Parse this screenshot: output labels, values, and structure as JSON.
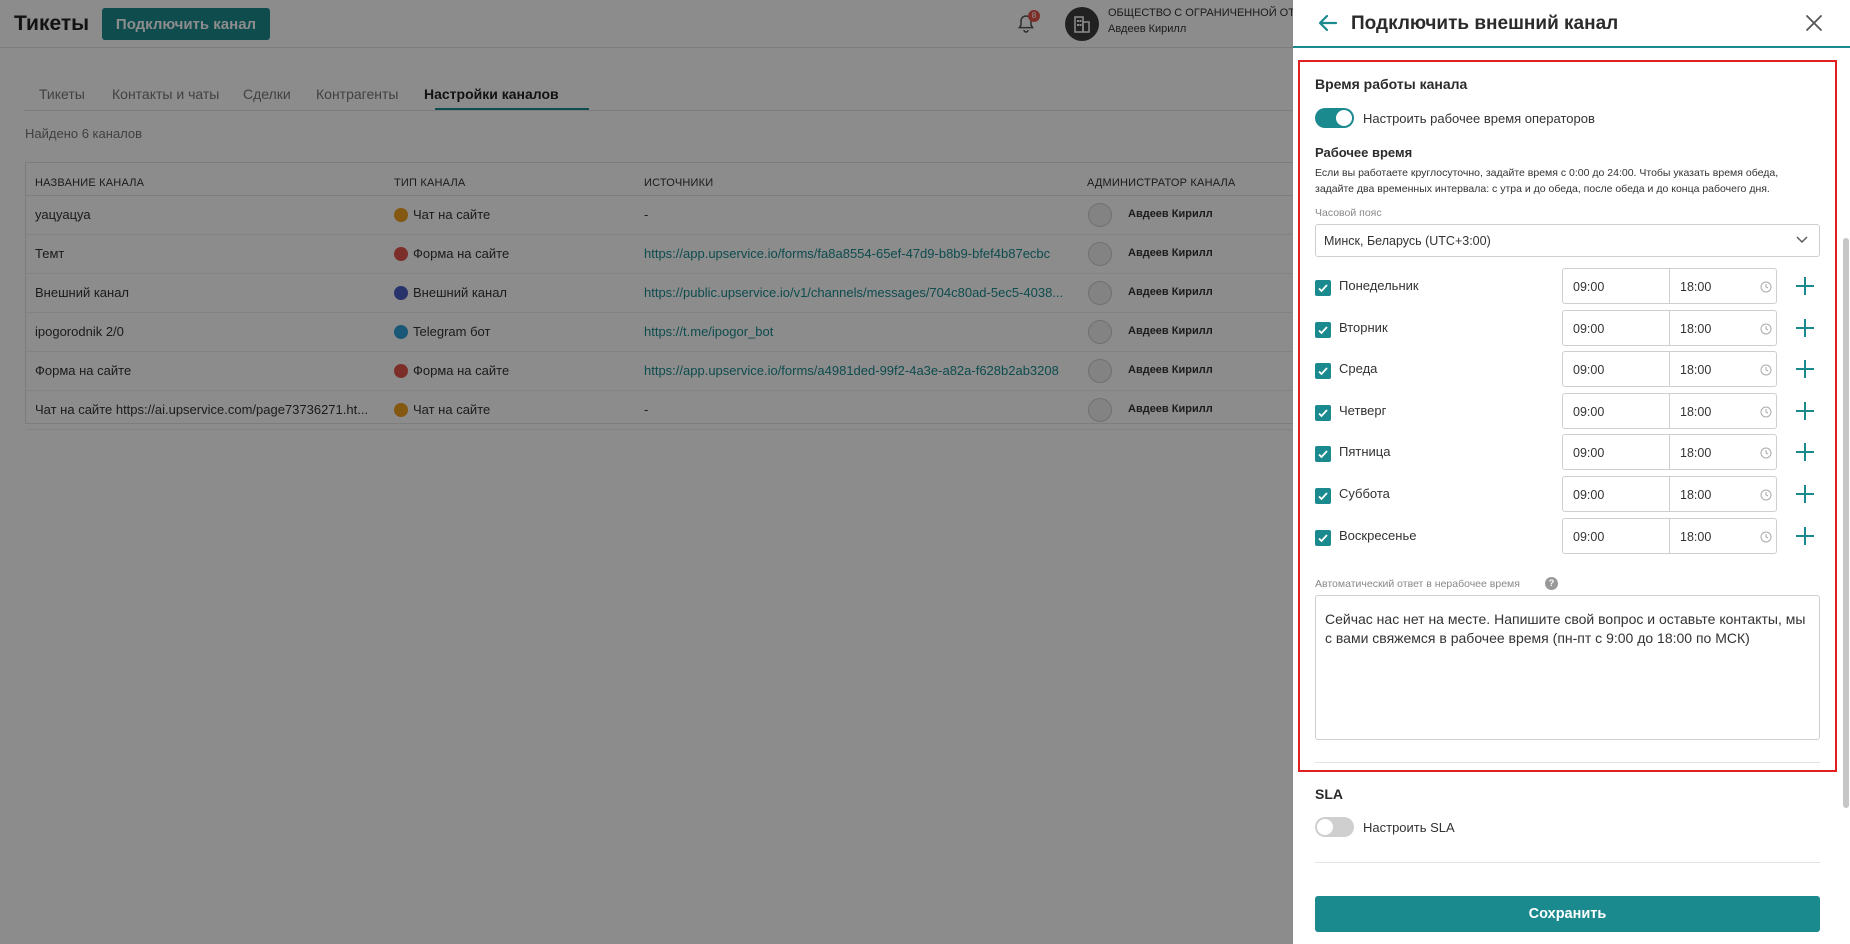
{
  "app": {
    "title": "Тикеты",
    "connect_button": "Подключить канал",
    "notifications_count": "8",
    "org_name": "ОБЩЕСТВО С ОГРАНИЧЕННОЙ ОТВ",
    "user_name": "Авдеев Кирилл"
  },
  "tabs": [
    "Тикеты",
    "Контакты и чаты",
    "Сделки",
    "Контрагенты",
    "Настройки каналов"
  ],
  "found_text": "Найдено 6 каналов",
  "table": {
    "headers": [
      "НАЗВАНИЕ КАНАЛА",
      "ТИП КАНАЛА",
      "ИСТОЧНИКИ",
      "АДМИНИСТРАТОР КАНАЛА"
    ],
    "rows": [
      {
        "name": "уацуацуа",
        "type": "Чат на сайте",
        "type_color": "#f0a020",
        "source": "-",
        "admin": "Авдеев Кирилл"
      },
      {
        "name": "Темт",
        "type": "Форма на сайте",
        "type_color": "#e2574c",
        "source": "https://app.upservice.io/forms/fa8a8554-65ef-47d9-b8b9-bfef4b87ecbc",
        "admin": "Авдеев Кирилл"
      },
      {
        "name": "Внешний канал",
        "type": "Внешний канал",
        "type_color": "#4a5bc4",
        "source": "https://public.upservice.io/v1/channels/messages/704c80ad-5ec5-4038...",
        "admin": "Авдеев Кирилл"
      },
      {
        "name": "ipogorodnik 2/0",
        "type": "Telegram бот",
        "type_color": "#2ea0d8",
        "source": "https://t.me/ipogor_bot",
        "admin": "Авдеев Кирилл"
      },
      {
        "name": "Форма на сайте",
        "type": "Форма на сайте",
        "type_color": "#e2574c",
        "source": "https://app.upservice.io/forms/a4981ded-99f2-4a3e-a82a-f628b2ab3208",
        "admin": "Авдеев Кирилл"
      },
      {
        "name": "Чат на сайте https://ai.upservice.com/page73736271.ht...",
        "type": "Чат на сайте",
        "type_color": "#f0a020",
        "source": "-",
        "admin": "Авдеев Кирилл"
      }
    ]
  },
  "panel": {
    "title": "Подключить внешний канал",
    "work_time": {
      "section_title": "Время работы канала",
      "toggle_label": "Настроить рабочее время операторов",
      "toggle_on": true,
      "sub_title": "Рабочее время",
      "hint": "Если вы работаете круглосуточно, задайте время с 0:00 до 24:00. Чтобы указать время обеда, задайте два временных интервала: с утра и до обеда, после обеда и до конца рабочего дня.",
      "timezone_label": "Часовой пояс",
      "timezone_value": "Минск, Беларусь (UTC+3:00)",
      "days": [
        {
          "label": "Понедельник",
          "from": "09:00",
          "to": "18:00",
          "checked": true
        },
        {
          "label": "Вторник",
          "from": "09:00",
          "to": "18:00",
          "checked": true
        },
        {
          "label": "Среда",
          "from": "09:00",
          "to": "18:00",
          "checked": true
        },
        {
          "label": "Четверг",
          "from": "09:00",
          "to": "18:00",
          "checked": true
        },
        {
          "label": "Пятница",
          "from": "09:00",
          "to": "18:00",
          "checked": true
        },
        {
          "label": "Суббота",
          "from": "09:00",
          "to": "18:00",
          "checked": true
        },
        {
          "label": "Воскресенье",
          "from": "09:00",
          "to": "18:00",
          "checked": true
        }
      ],
      "auto_reply_label": "Автоматический ответ в нерабочее время",
      "auto_reply_text": "Сейчас нас нет на месте. Напишите свой вопрос и оставьте контакты, мы с вами свяжемся в рабочее время (пн-пт с 9:00 до 18:00 по МСК)"
    },
    "sla": {
      "section_title": "SLA",
      "toggle_label": "Настроить SLA",
      "toggle_on": false
    },
    "save_button": "Сохранить"
  },
  "colors": {
    "accent": "#1a8a8f",
    "highlight": "#e02020",
    "overlay": "rgba(0,0,0,0.45)"
  }
}
